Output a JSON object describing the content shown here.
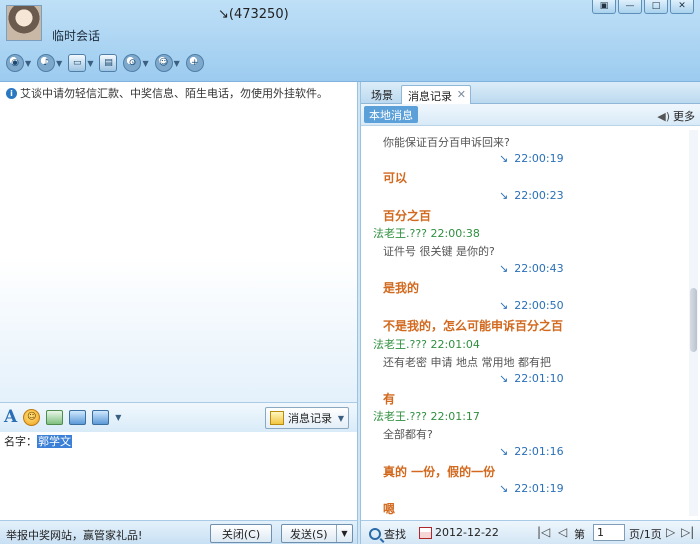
{
  "window": {
    "title_number": "↘(473250)",
    "contact_name": "临时会话",
    "controls": [
      "▣",
      "—",
      "□",
      "✕"
    ]
  },
  "toolbar": {
    "items": [
      {
        "icon": "video-icon",
        "glyph": "◉"
      },
      {
        "icon": "microphone-icon",
        "glyph": "♪"
      },
      {
        "icon": "file-transfer-icon",
        "glyph": "▭"
      },
      {
        "icon": "app-icon",
        "glyph": "▤"
      },
      {
        "icon": "share-icon",
        "glyph": "⊙"
      },
      {
        "icon": "contact-icon",
        "glyph": "☺"
      },
      {
        "icon": "add-contact-icon",
        "glyph": "+"
      }
    ]
  },
  "chat": {
    "notice": "艾谈中请勿轻信汇款、中奖信息、陌生电话，勿使用外挂软件。"
  },
  "input_toolbar": {
    "font_label": "A",
    "message_log_label": "消息记录"
  },
  "input": {
    "name_prefix": "名字：",
    "name_selected": "郭学文"
  },
  "bottom": {
    "promo": "举报中奖网站，赢管家礼品!",
    "close_label": "关闭(C)",
    "send_label": "发送(S)"
  },
  "history_panel": {
    "tabs": [
      "场景",
      "消息记录"
    ],
    "local_tab": "本地消息",
    "more_label": "更多",
    "messages": [
      {
        "kind": "gray",
        "text": "你能保证百分百申诉回来?"
      },
      {
        "kind": "time",
        "text": "22:00:19"
      },
      {
        "kind": "orange",
        "text": "可以"
      },
      {
        "kind": "time",
        "text": "22:00:23"
      },
      {
        "kind": "orange",
        "text": "百分之百"
      },
      {
        "kind": "sender",
        "text": "法老王.??? 22:00:38"
      },
      {
        "kind": "gray",
        "text": "证件号  很关键  是你的?"
      },
      {
        "kind": "time",
        "text": "22:00:43"
      },
      {
        "kind": "orange",
        "text": "是我的"
      },
      {
        "kind": "time",
        "text": "22:00:50"
      },
      {
        "kind": "orange",
        "text": "不是我的，怎么可能申诉百分之百"
      },
      {
        "kind": "sender",
        "text": "法老王.??? 22:01:04"
      },
      {
        "kind": "gray",
        "text": "还有老密    申请  地点  常用地    都有把"
      },
      {
        "kind": "time",
        "text": "22:01:10"
      },
      {
        "kind": "orange",
        "text": "有"
      },
      {
        "kind": "sender",
        "text": "法老王.??? 22:01:17"
      },
      {
        "kind": "gray",
        "text": "全部都有?"
      },
      {
        "kind": "time",
        "text": "22:01:16"
      },
      {
        "kind": "orange",
        "text": "真的    一份，假的一份"
      },
      {
        "kind": "time",
        "text": "22:01:19"
      },
      {
        "kind": "orange",
        "text": "嗯"
      }
    ],
    "pager": {
      "find_label": "查找",
      "date": "2012-12-22",
      "page_prefix": "第",
      "page_value": "1",
      "page_suffix": "页/1页"
    }
  }
}
